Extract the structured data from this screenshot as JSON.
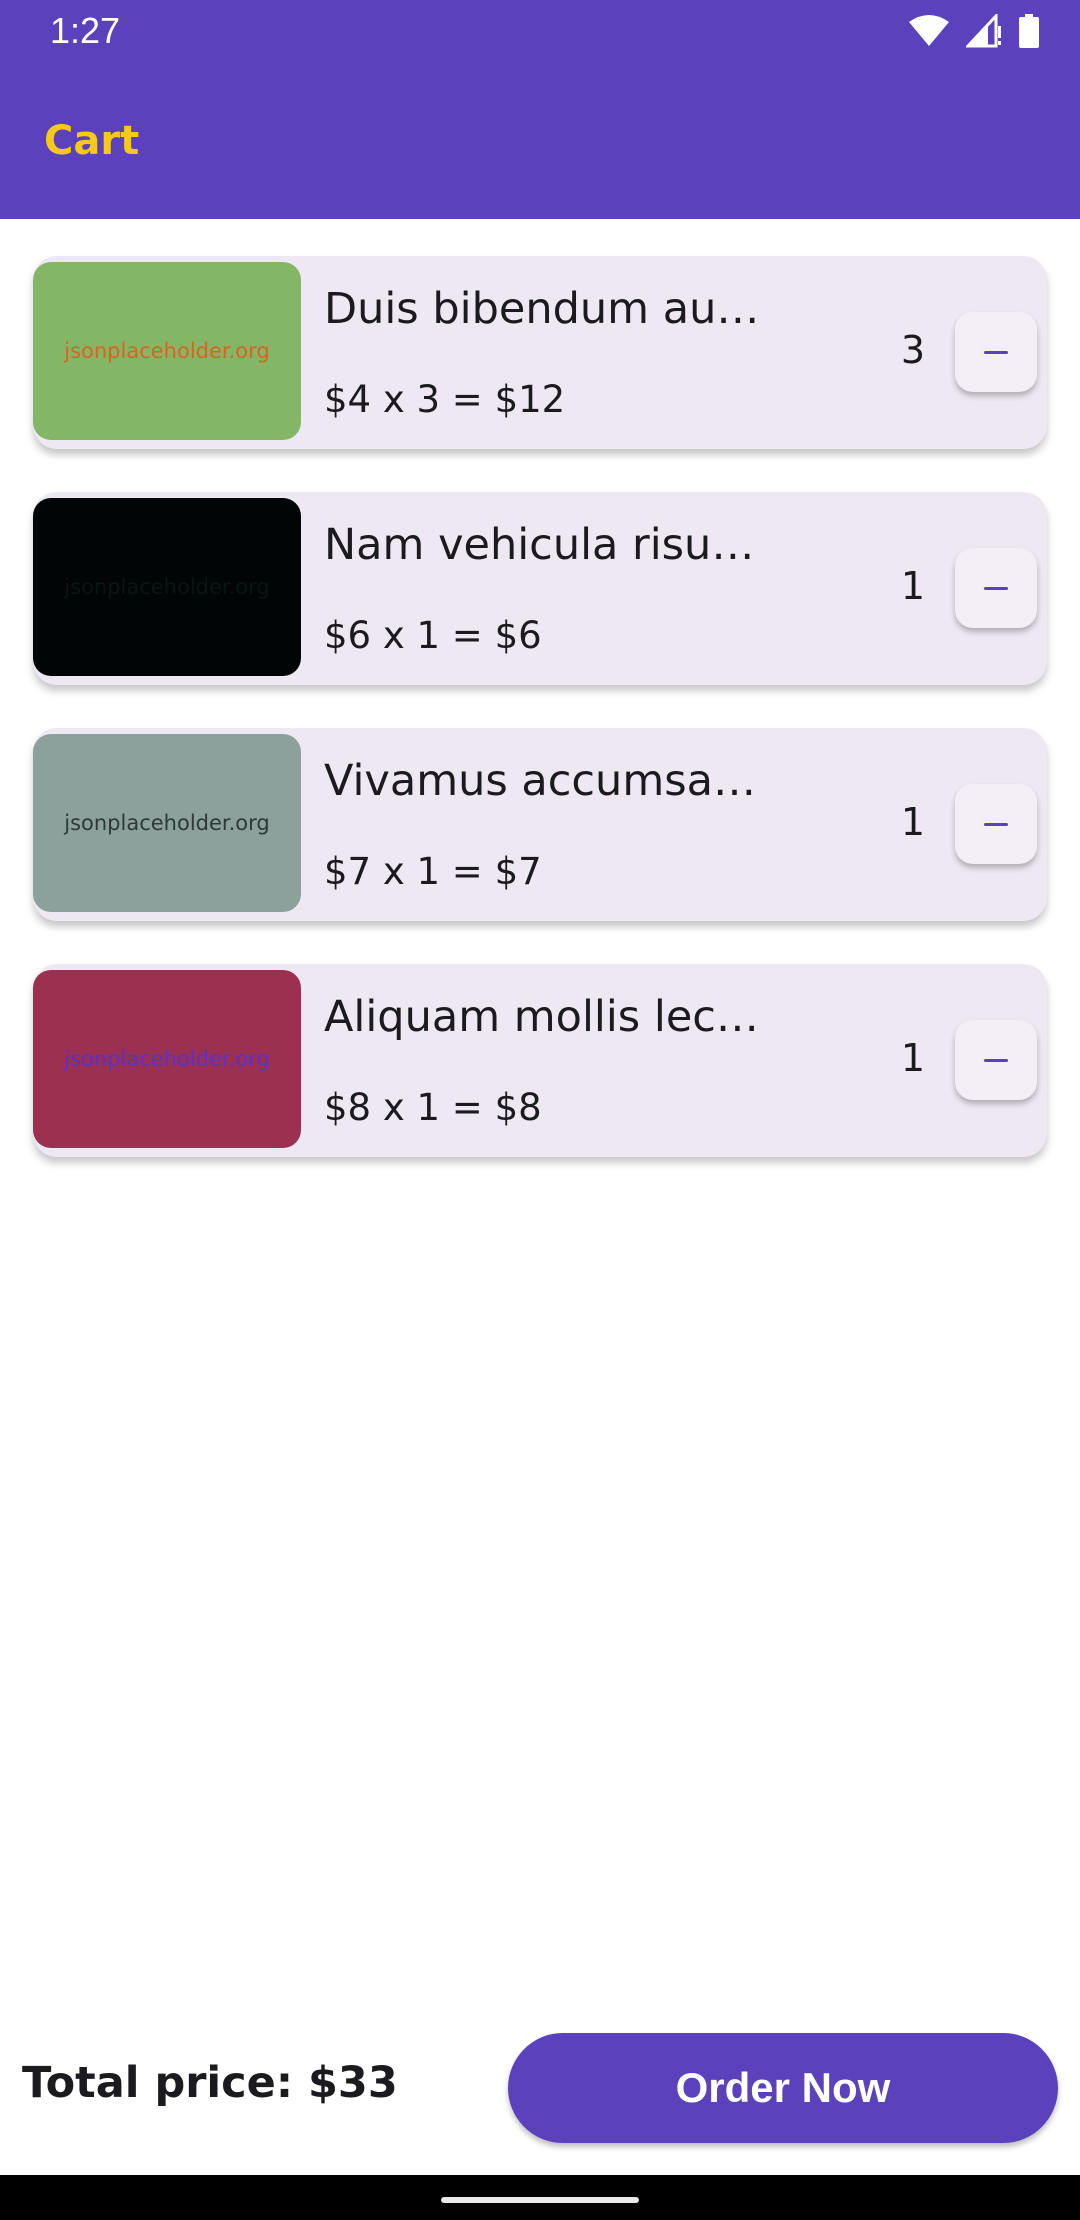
{
  "status_bar": {
    "time": "1:27",
    "icons": [
      "wifi-icon",
      "signal-icon",
      "battery-icon"
    ]
  },
  "app_bar": {
    "title": "Cart",
    "background": "#5c41bd",
    "title_color": "#f6c818"
  },
  "cart": {
    "items": [
      {
        "title": "Duis bibendum au…",
        "price": "$4 x 3 = $12",
        "quantity": "3",
        "thumbnail": {
          "text": "jsonplaceholder.org",
          "bg": "#84b765",
          "fg": "#d86421"
        }
      },
      {
        "title": "Nam vehicula risu…",
        "price": "$6 x 1 = $6",
        "quantity": "1",
        "thumbnail": {
          "text": "jsonplaceholder.org",
          "bg": "#020505",
          "fg": "#0a1512"
        }
      },
      {
        "title": "Vivamus accumsa…",
        "price": "$7 x 1 = $7",
        "quantity": "1",
        "thumbnail": {
          "text": "jsonplaceholder.org",
          "bg": "#8ca09c",
          "fg": "#2f3a37"
        }
      },
      {
        "title": "Aliquam mollis lec…",
        "price": "$8 x 1 = $8",
        "quantity": "1",
        "thumbnail": {
          "text": "jsonplaceholder.org",
          "bg": "#9b3051",
          "fg": "#5c2fd0"
        }
      }
    ],
    "decrement_icon": "minus-icon"
  },
  "footer": {
    "total_label": "Total price: $33",
    "order_button_label": "Order Now"
  }
}
